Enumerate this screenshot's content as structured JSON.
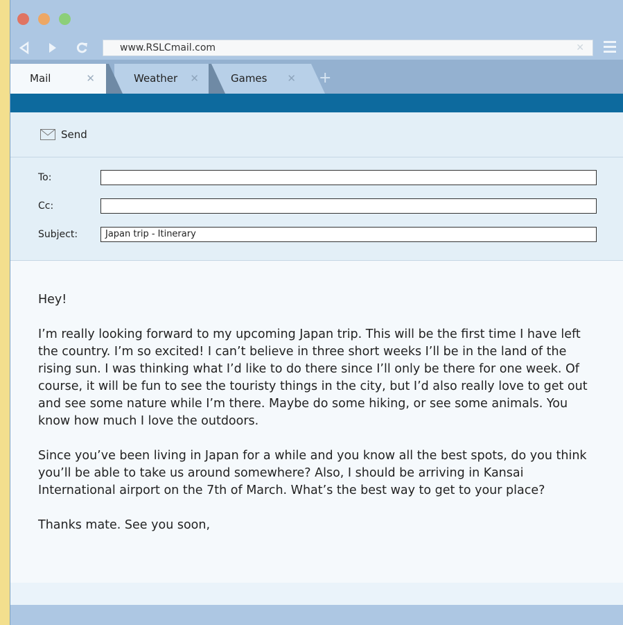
{
  "browser": {
    "url": "www.RSLCmail.com",
    "tabs": [
      {
        "label": "Mail",
        "active": true
      },
      {
        "label": "Weather",
        "active": false
      },
      {
        "label": "Games",
        "active": false
      }
    ],
    "new_tab": "+"
  },
  "toolbar": {
    "send_label": "Send"
  },
  "email": {
    "to_label": "To:",
    "to_value": "",
    "cc_label": "Cc:",
    "cc_value": "",
    "subject_label": "Subject:",
    "subject_value": "Japan trip - Itinerary",
    "greeting": "Hey!",
    "paragraph1": "I’m really looking forward to my upcoming Japan trip. This will be the first time I have left the country. I’m so excited! I can’t believe in three short weeks I’ll be in the land of the rising sun. I was thinking what I’d like to do there since I’ll only be there for one week. Of course, it will be fun to see the touristy things in the city, but I’d also really love to get out and see some nature while I’m there. Maybe do some hiking, or see some animals. You know how much I love the outdoors.",
    "paragraph2": "Since you’ve been living in Japan for a while and you know all the best spots, do you think you’ll be able to take us around somewhere? Also, I should be arriving in Kansai International airport on the 7th of March. What’s the best way to get to your place?",
    "signoff": "Thanks mate. See you soon,"
  }
}
